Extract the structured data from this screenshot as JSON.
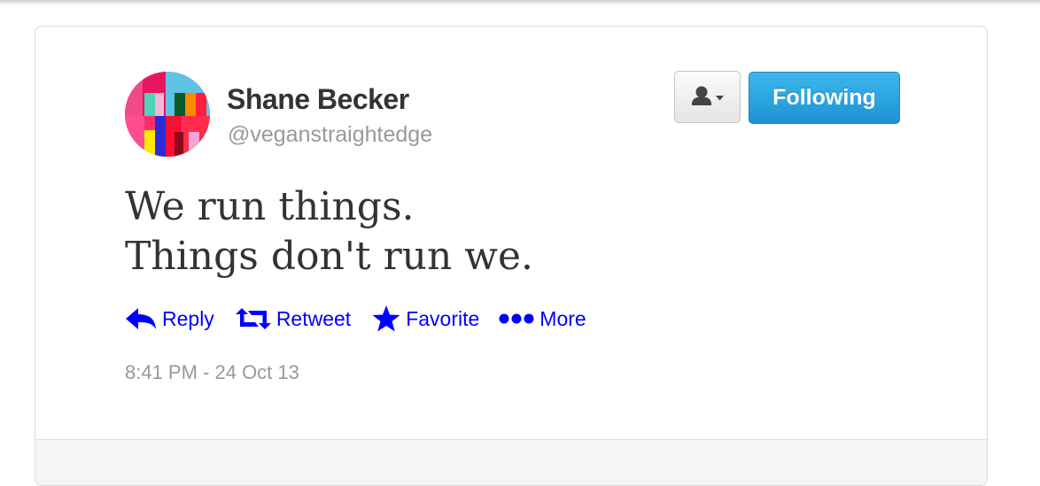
{
  "tweet": {
    "author_name": "Shane Becker",
    "author_handle": "@veganstraightedge",
    "text_lines": [
      "We run things.",
      "Things don't run we."
    ],
    "timestamp": "8:41 PM - 24 Oct 13"
  },
  "buttons": {
    "following_label": "Following",
    "user_menu_icon": "person-dropdown-icon"
  },
  "actions": [
    {
      "label": "Reply",
      "icon": "reply-arrow-icon"
    },
    {
      "label": "Retweet",
      "icon": "retweet-icon"
    },
    {
      "label": "Favorite",
      "icon": "star-icon"
    },
    {
      "label": "More",
      "icon": "more-dots-icon"
    }
  ],
  "colors": {
    "action_link": "#0000ff",
    "follow_button": "#2aa3e3",
    "text": "#333333",
    "muted": "#999999"
  }
}
